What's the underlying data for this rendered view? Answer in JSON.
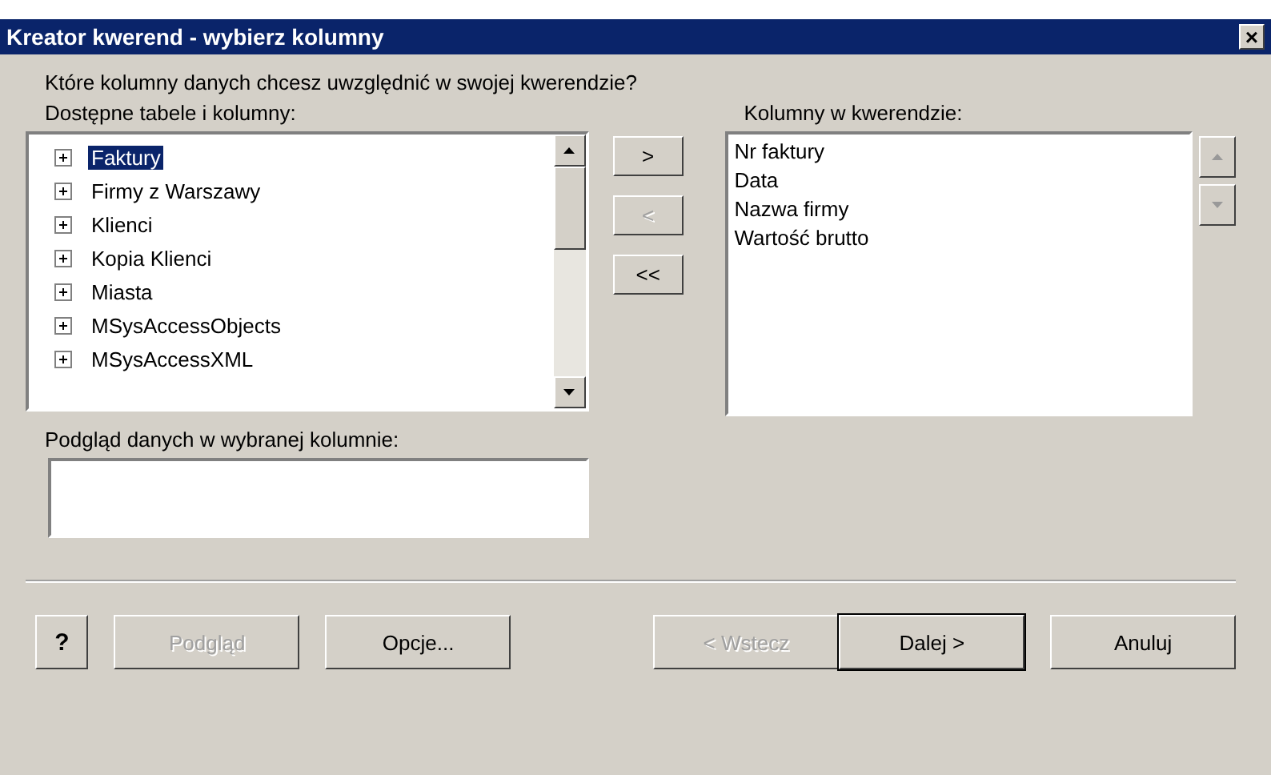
{
  "window": {
    "title": "Kreator kwerend - wybierz kolumny",
    "close": "×"
  },
  "question": "Które kolumny danych chcesz uwzględnić w swojej kwerendzie?",
  "available": {
    "label": "Dostępne tabele i kolumny:",
    "items": [
      {
        "label": "Faktury",
        "selected": true
      },
      {
        "label": "Firmy z Warszawy",
        "selected": false
      },
      {
        "label": "Klienci",
        "selected": false
      },
      {
        "label": "Kopia Klienci",
        "selected": false
      },
      {
        "label": "Miasta",
        "selected": false
      },
      {
        "label": "MSysAccessObjects",
        "selected": false
      },
      {
        "label": "MSysAccessXML",
        "selected": false
      }
    ]
  },
  "move_buttons": [
    {
      "label": ">",
      "disabled": false
    },
    {
      "label": "<",
      "disabled": true
    },
    {
      "label": "<<",
      "disabled": false
    }
  ],
  "selected_columns": {
    "label": "Kolumny w kwerendzie:",
    "items": [
      "Nr faktury",
      "Data",
      "Nazwa firmy",
      "Wartość brutto"
    ]
  },
  "preview": {
    "label": "Podgląd danych w wybranej kolumnie:"
  },
  "footer_buttons": [
    {
      "kind": "help",
      "label": "?"
    },
    {
      "kind": "button",
      "label": "Podgląd",
      "disabled": true
    },
    {
      "kind": "button",
      "label": "Opcje...",
      "disabled": false
    },
    {
      "kind": "spacer"
    },
    {
      "kind": "button",
      "label": "< Wstecz",
      "disabled": true
    },
    {
      "kind": "default",
      "label": "Dalej >",
      "disabled": false
    },
    {
      "kind": "button",
      "label": "Anuluj",
      "disabled": false
    }
  ]
}
